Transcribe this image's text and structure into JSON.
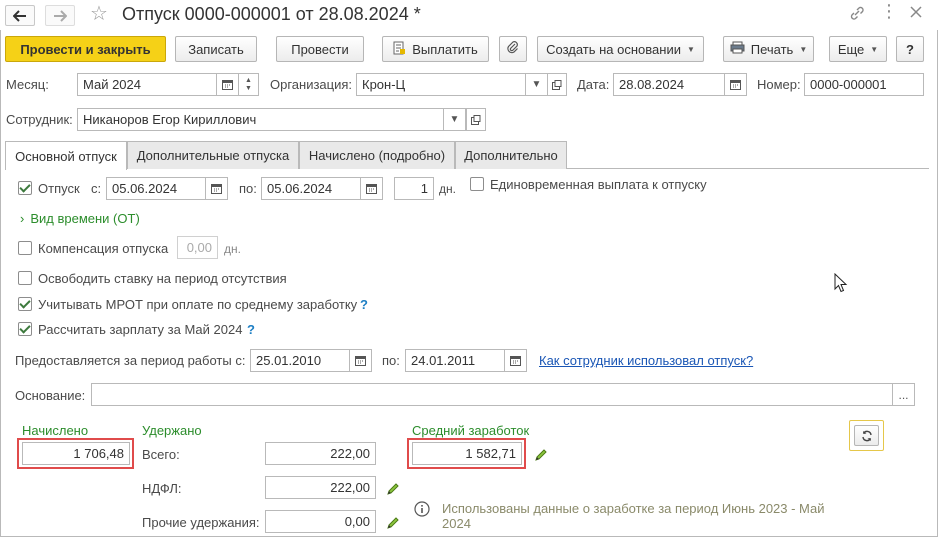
{
  "window": {
    "title": "Отпуск 0000-000001 от 28.08.2024 *"
  },
  "toolbar": {
    "post_close": "Провести и закрыть",
    "save": "Записать",
    "post": "Провести",
    "pay": "Выплатить",
    "create_based": "Создать на основании",
    "print": "Печать",
    "more": "Еще",
    "help": "?"
  },
  "header": {
    "month_label": "Месяц:",
    "month_value": "Май 2024",
    "org_label": "Организация:",
    "org_value": "Крон-Ц",
    "date_label": "Дата:",
    "date_value": "28.08.2024",
    "number_label": "Номер:",
    "number_value": "0000-000001",
    "employee_label": "Сотрудник:",
    "employee_value": "Никаноров Егор Кириллович"
  },
  "tabs": [
    {
      "label": "Основной отпуск",
      "active": true
    },
    {
      "label": "Дополнительные отпуска",
      "active": false
    },
    {
      "label": "Начислено (подробно)",
      "active": false
    },
    {
      "label": "Дополнительно",
      "active": false
    }
  ],
  "vacation": {
    "checkbox_label": "Отпуск",
    "checked": true,
    "from_label": "с:",
    "from_value": "05.06.2024",
    "to_label": "по:",
    "to_value": "05.06.2024",
    "days_value": "1",
    "days_unit": "дн.",
    "lump_sum_label": "Единовременная выплата к отпуску",
    "lump_sum_checked": false
  },
  "time_type_link": "Вид времени (ОТ)",
  "compensation": {
    "label": "Компенсация отпуска",
    "checked": false,
    "value": "0,00",
    "unit": "дн."
  },
  "options": [
    {
      "label": "Освободить ставку на период отсутствия",
      "checked": false,
      "help": false
    },
    {
      "label": "Учитывать МРОТ при оплате по среднему заработку",
      "checked": true,
      "help": true
    },
    {
      "label": "Рассчитать зарплату за Май 2024",
      "checked": true,
      "help": true
    }
  ],
  "help_mark": "?",
  "period": {
    "label": "Предоставляется за период работы с:",
    "from_value": "25.01.2010",
    "to_label": "по:",
    "to_value": "24.01.2011",
    "link": "Как сотрудник использовал отпуск?"
  },
  "basis": {
    "label": "Основание:",
    "value": "",
    "button": "..."
  },
  "totals": {
    "accrued_label": "Начислено",
    "accrued_value": "1 706,48",
    "withheld_label": "Удержано",
    "total_label": "Всего:",
    "total_value": "222,00",
    "ndfl_label": "НДФЛ:",
    "ndfl_value": "222,00",
    "other_label": "Прочие удержания:",
    "other_value": "0,00",
    "avg_label": "Средний заработок",
    "avg_value": "1 582,71",
    "info_text_1": "Использованы данные о заработке за период Июнь 2023 - Май",
    "info_text_2": "2024"
  },
  "colors": {
    "primary_button": "#f5d117",
    "green_text": "#2c8d2c",
    "link_blue": "#1a56b5",
    "highlight_red": "#e04b4b"
  }
}
